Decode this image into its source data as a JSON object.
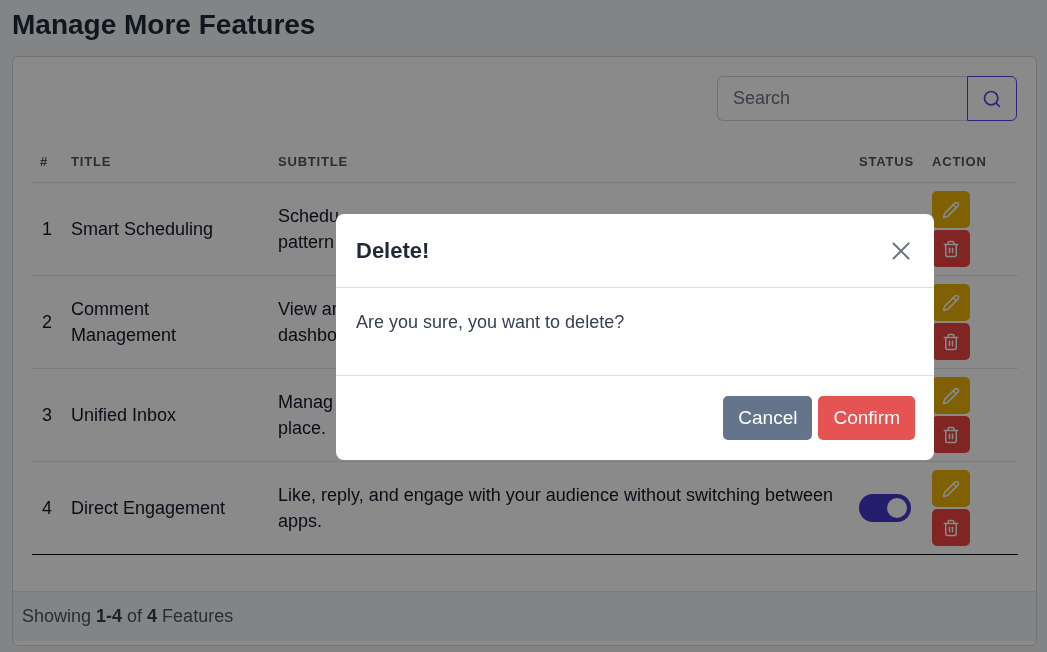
{
  "page": {
    "title": "Manage More Features"
  },
  "search": {
    "placeholder": "Search"
  },
  "table": {
    "columns": [
      "#",
      "TITLE",
      "SUBTITLE",
      "STATUS",
      "ACTION"
    ],
    "rows": [
      {
        "number": "1",
        "title": "Smart Scheduling",
        "subtitle": "Schedu\npattern"
      },
      {
        "number": "2",
        "title": "Comment Management",
        "subtitle": "View ar\ndashbo"
      },
      {
        "number": "3",
        "title": "Unified Inbox",
        "subtitle": "Manag\nplace."
      },
      {
        "number": "4",
        "title": "Direct Engagement",
        "subtitle": "Like, reply, and engage with your audience without switching between apps.",
        "status_on": true
      }
    ]
  },
  "footer": {
    "summary": "Showing **1-4** of **4** Features"
  },
  "dialog": {
    "title": "Delete!",
    "message": "Are you sure, you want to delete?",
    "buttons": [
      {
        "label": "Cancel",
        "kind": "secondary"
      },
      {
        "label": "Confirm",
        "kind": "danger"
      }
    ]
  }
}
